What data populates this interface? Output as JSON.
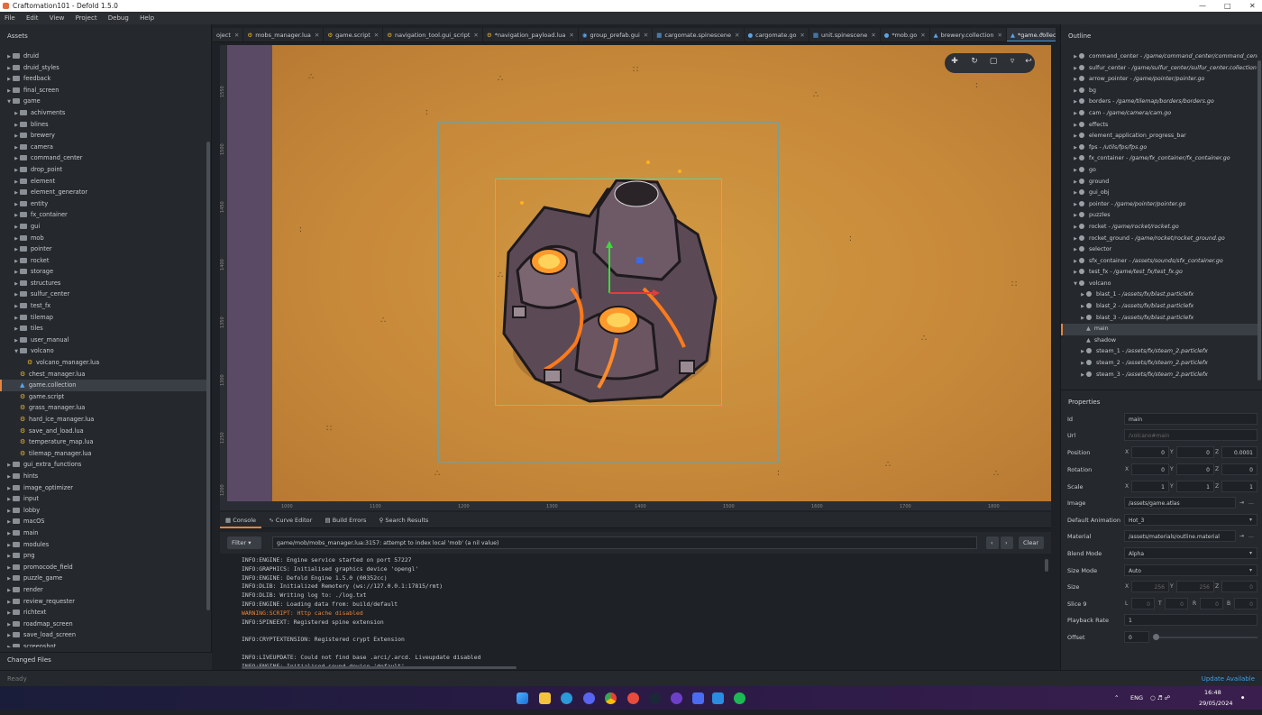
{
  "window": {
    "title": "Craftomation101 - Defold 1.5.0"
  },
  "menu": [
    "File",
    "Edit",
    "View",
    "Project",
    "Debug",
    "Help"
  ],
  "assets": {
    "title": "Assets",
    "items": [
      {
        "label": "druid",
        "depth": 1,
        "type": "folder",
        "open": false
      },
      {
        "label": "druid_styles",
        "depth": 1,
        "type": "folder",
        "open": false
      },
      {
        "label": "feedback",
        "depth": 1,
        "type": "folder",
        "open": false
      },
      {
        "label": "final_screen",
        "depth": 1,
        "type": "folder",
        "open": false
      },
      {
        "label": "game",
        "depth": 1,
        "type": "folder",
        "open": true
      },
      {
        "label": "achivments",
        "depth": 2,
        "type": "folder",
        "open": false
      },
      {
        "label": "blines",
        "depth": 2,
        "type": "folder",
        "open": false
      },
      {
        "label": "brewery",
        "depth": 2,
        "type": "folder",
        "open": false
      },
      {
        "label": "camera",
        "depth": 2,
        "type": "folder",
        "open": false
      },
      {
        "label": "command_center",
        "depth": 2,
        "type": "folder",
        "open": false
      },
      {
        "label": "drop_point",
        "depth": 2,
        "type": "folder",
        "open": false
      },
      {
        "label": "element",
        "depth": 2,
        "type": "folder",
        "open": false
      },
      {
        "label": "element_generator",
        "depth": 2,
        "type": "folder",
        "open": false
      },
      {
        "label": "entity",
        "depth": 2,
        "type": "folder",
        "open": false
      },
      {
        "label": "fx_container",
        "depth": 2,
        "type": "folder",
        "open": false
      },
      {
        "label": "gui",
        "depth": 2,
        "type": "folder",
        "open": false
      },
      {
        "label": "mob",
        "depth": 2,
        "type": "folder",
        "open": false
      },
      {
        "label": "pointer",
        "depth": 2,
        "type": "folder",
        "open": false
      },
      {
        "label": "rocket",
        "depth": 2,
        "type": "folder",
        "open": false
      },
      {
        "label": "storage",
        "depth": 2,
        "type": "folder",
        "open": false
      },
      {
        "label": "structures",
        "depth": 2,
        "type": "folder",
        "open": false
      },
      {
        "label": "sulfur_center",
        "depth": 2,
        "type": "folder",
        "open": false
      },
      {
        "label": "test_fx",
        "depth": 2,
        "type": "folder",
        "open": false
      },
      {
        "label": "tilemap",
        "depth": 2,
        "type": "folder",
        "open": false
      },
      {
        "label": "tiles",
        "depth": 2,
        "type": "folder",
        "open": false
      },
      {
        "label": "user_manual",
        "depth": 2,
        "type": "folder",
        "open": false
      },
      {
        "label": "volcano",
        "depth": 2,
        "type": "folder",
        "open": true
      },
      {
        "label": "volcano_manager.lua",
        "depth": 3,
        "type": "script"
      },
      {
        "label": "chest_manager.lua",
        "depth": 2,
        "type": "script"
      },
      {
        "label": "game.collection",
        "depth": 2,
        "type": "collection",
        "selected": true
      },
      {
        "label": "game.script",
        "depth": 2,
        "type": "script"
      },
      {
        "label": "grass_manager.lua",
        "depth": 2,
        "type": "script"
      },
      {
        "label": "hard_ice_manager.lua",
        "depth": 2,
        "type": "script"
      },
      {
        "label": "save_and_load.lua",
        "depth": 2,
        "type": "script"
      },
      {
        "label": "temperature_map.lua",
        "depth": 2,
        "type": "script"
      },
      {
        "label": "tilemap_manager.lua",
        "depth": 2,
        "type": "script"
      },
      {
        "label": "gui_extra_functions",
        "depth": 1,
        "type": "folder",
        "open": false
      },
      {
        "label": "hints",
        "depth": 1,
        "type": "folder",
        "open": false
      },
      {
        "label": "image_optimizer",
        "depth": 1,
        "type": "folder",
        "open": false
      },
      {
        "label": "input",
        "depth": 1,
        "type": "folder",
        "open": false
      },
      {
        "label": "lobby",
        "depth": 1,
        "type": "folder",
        "open": false
      },
      {
        "label": "macOS",
        "depth": 1,
        "type": "folder",
        "open": false
      },
      {
        "label": "main",
        "depth": 1,
        "type": "folder",
        "open": false
      },
      {
        "label": "modules",
        "depth": 1,
        "type": "folder",
        "open": false
      },
      {
        "label": "png",
        "depth": 1,
        "type": "folder",
        "open": false
      },
      {
        "label": "promocode_field",
        "depth": 1,
        "type": "folder",
        "open": false
      },
      {
        "label": "puzzle_game",
        "depth": 1,
        "type": "folder",
        "open": false
      },
      {
        "label": "render",
        "depth": 1,
        "type": "folder",
        "open": false
      },
      {
        "label": "review_requester",
        "depth": 1,
        "type": "folder",
        "open": false
      },
      {
        "label": "richtext",
        "depth": 1,
        "type": "folder",
        "open": false
      },
      {
        "label": "roadmap_screen",
        "depth": 1,
        "type": "folder",
        "open": false
      },
      {
        "label": "save_load_screen",
        "depth": 1,
        "type": "folder",
        "open": false
      },
      {
        "label": "screenshot",
        "depth": 1,
        "type": "folder",
        "open": false
      }
    ]
  },
  "changed_files": "Changed Files",
  "tabs": [
    {
      "label": "oject",
      "icon": ""
    },
    {
      "label": "mobs_manager.lua",
      "icon": "gear"
    },
    {
      "label": "game.script",
      "icon": "gear"
    },
    {
      "label": "navigation_tool.gui_script",
      "icon": "gear"
    },
    {
      "label": "*navigation_payload.lua",
      "icon": "gear"
    },
    {
      "label": "group_prefab.gui",
      "icon": "eye"
    },
    {
      "label": "cargomate.spinescene",
      "icon": "box"
    },
    {
      "label": "cargomate.go",
      "icon": "dot"
    },
    {
      "label": "unit.spinescene",
      "icon": "box"
    },
    {
      "label": "*mob.go",
      "icon": "dot"
    },
    {
      "label": "brewery.collection",
      "icon": "coll"
    },
    {
      "label": "*game.collection",
      "icon": "coll",
      "active": true
    }
  ],
  "ruler": {
    "left": [
      "1550",
      "1500",
      "1450",
      "1400",
      "1350",
      "1300",
      "1250",
      "1200"
    ],
    "bottom": [
      "1000",
      "1100",
      "1200",
      "1300",
      "1400",
      "1500",
      "1600",
      "1700",
      "1800"
    ]
  },
  "bottom_tabs": [
    "Console",
    "Curve Editor",
    "Build Errors",
    "Search Results"
  ],
  "filter": {
    "label": "Filter",
    "value": "game/mob/mobs_manager.lua:3157: attempt to index local 'mob' (a nil value)",
    "clear": "Clear"
  },
  "console": [
    {
      "t": "INFO:ENGINE: Engine service started on port 57227",
      "w": false
    },
    {
      "t": "INFO:GRAPHICS: Initialised graphics device 'opengl'",
      "w": false
    },
    {
      "t": "INFO:ENGINE: Defold Engine 1.5.0 (00352cc)",
      "w": false
    },
    {
      "t": "INFO:DLIB: Initialized Remotery (ws://127.0.0.1:17815/rmt)",
      "w": false
    },
    {
      "t": "INFO:DLIB: Writing log to: ./log.txt",
      "w": false
    },
    {
      "t": "INFO:ENGINE: Loading data from: build/default",
      "w": false
    },
    {
      "t": "WARNING:SCRIPT: Http cache disabled",
      "w": true
    },
    {
      "t": "INFO:SPINEEXT: Registered spine extension",
      "w": false
    },
    {
      "t": "",
      "w": false
    },
    {
      "t": "INFO:CRYPTEXTENSION: Registered crypt Extension",
      "w": false
    },
    {
      "t": "",
      "w": false
    },
    {
      "t": "INFO:LIVEUPDATE: Could not find base .arci/.arcd. Liveupdate disabled",
      "w": false
    },
    {
      "t": "INFO:ENGINE: Initialised sound device 'default'",
      "w": false
    }
  ],
  "outline": {
    "title": "Outline",
    "items": [
      {
        "name": "command_center",
        "path": " - /game/command_center/command_center.c",
        "depth": 1
      },
      {
        "name": "sulfur_center",
        "path": " - /game/sulfur_center/sulfur_center.collection",
        "depth": 1
      },
      {
        "name": "arrow_pointer",
        "path": " - /game/pointer/pointer.go",
        "depth": 1
      },
      {
        "name": "bg",
        "path": "",
        "depth": 1
      },
      {
        "name": "borders",
        "path": " - /game/tilemap/borders/borders.go",
        "depth": 1
      },
      {
        "name": "cam",
        "path": " - /game/camera/cam.go",
        "depth": 1
      },
      {
        "name": "effects",
        "path": "",
        "depth": 1
      },
      {
        "name": "element_application_progress_bar",
        "path": "",
        "depth": 1
      },
      {
        "name": "fps",
        "path": " - /utils/fps/fps.go",
        "depth": 1
      },
      {
        "name": "fx_container",
        "path": " - /game/fx_container/fx_container.go",
        "depth": 1
      },
      {
        "name": "go",
        "path": "",
        "depth": 1
      },
      {
        "name": "ground",
        "path": "",
        "depth": 1
      },
      {
        "name": "gui_obj",
        "path": "",
        "depth": 1
      },
      {
        "name": "pointer",
        "path": " - /game/pointer/pointer.go",
        "depth": 1
      },
      {
        "name": "puzzles",
        "path": "",
        "depth": 1
      },
      {
        "name": "rocket",
        "path": " - /game/rocket/rocket.go",
        "depth": 1
      },
      {
        "name": "rocket_ground",
        "path": " - /game/rocket/rocket_ground.go",
        "depth": 1
      },
      {
        "name": "selector",
        "path": "",
        "depth": 1
      },
      {
        "name": "sfx_container",
        "path": " - /assets/sounds/sfx_container.go",
        "depth": 1
      },
      {
        "name": "test_fx",
        "path": " - /game/test_fx/test_fx.go",
        "depth": 1
      },
      {
        "name": "volcano",
        "path": "",
        "depth": 1,
        "open": true
      },
      {
        "name": "blast_1",
        "path": " - /assets/fx/blast.particlefx",
        "depth": 2
      },
      {
        "name": "blast_2",
        "path": " - /assets/fx/blast.particlefx",
        "depth": 2
      },
      {
        "name": "blast_3",
        "path": " - /assets/fx/blast.particlefx",
        "depth": 2
      },
      {
        "name": "main",
        "path": "",
        "depth": 2,
        "selected": true
      },
      {
        "name": "shadow",
        "path": "",
        "depth": 2
      },
      {
        "name": "steam_1",
        "path": " - /assets/fx/steam_2.particlefx",
        "depth": 2
      },
      {
        "name": "steam_2",
        "path": " - /assets/fx/steam_2.particlefx",
        "depth": 2
      },
      {
        "name": "steam_3",
        "path": " - /assets/fx/steam_2.particlefx",
        "depth": 2
      }
    ]
  },
  "properties": {
    "title": "Properties",
    "id": {
      "label": "Id",
      "value": "main"
    },
    "url": {
      "label": "Url",
      "value": "/volcano#main"
    },
    "position": {
      "label": "Position",
      "x": "0",
      "y": "0",
      "z": "0.0001"
    },
    "rotation": {
      "label": "Rotation",
      "x": "0",
      "y": "0",
      "z": "0"
    },
    "scale": {
      "label": "Scale",
      "x": "1",
      "y": "1",
      "z": "1"
    },
    "image": {
      "label": "Image",
      "value": "/assets/game.atlas"
    },
    "default_animation": {
      "label": "Default Animation",
      "value": "Hot_3"
    },
    "material": {
      "label": "Material",
      "value": "/assets/materials/outline.material"
    },
    "blend_mode": {
      "label": "Blend Mode",
      "value": "Alpha"
    },
    "size_mode": {
      "label": "Size Mode",
      "value": "Auto"
    },
    "size": {
      "label": "Size",
      "x": "256",
      "y": "256",
      "z": "0"
    },
    "slice9": {
      "label": "Slice 9",
      "l": "0",
      "t": "0",
      "r": "0",
      "b": "0"
    },
    "playback_rate": {
      "label": "Playback Rate",
      "value": "1"
    },
    "offset": {
      "label": "Offset",
      "value": "0"
    }
  },
  "status": {
    "ready": "Ready",
    "update": "Update Available"
  },
  "tray": {
    "lang": "ENG",
    "time": "16:48",
    "date": "29/05/2024"
  }
}
